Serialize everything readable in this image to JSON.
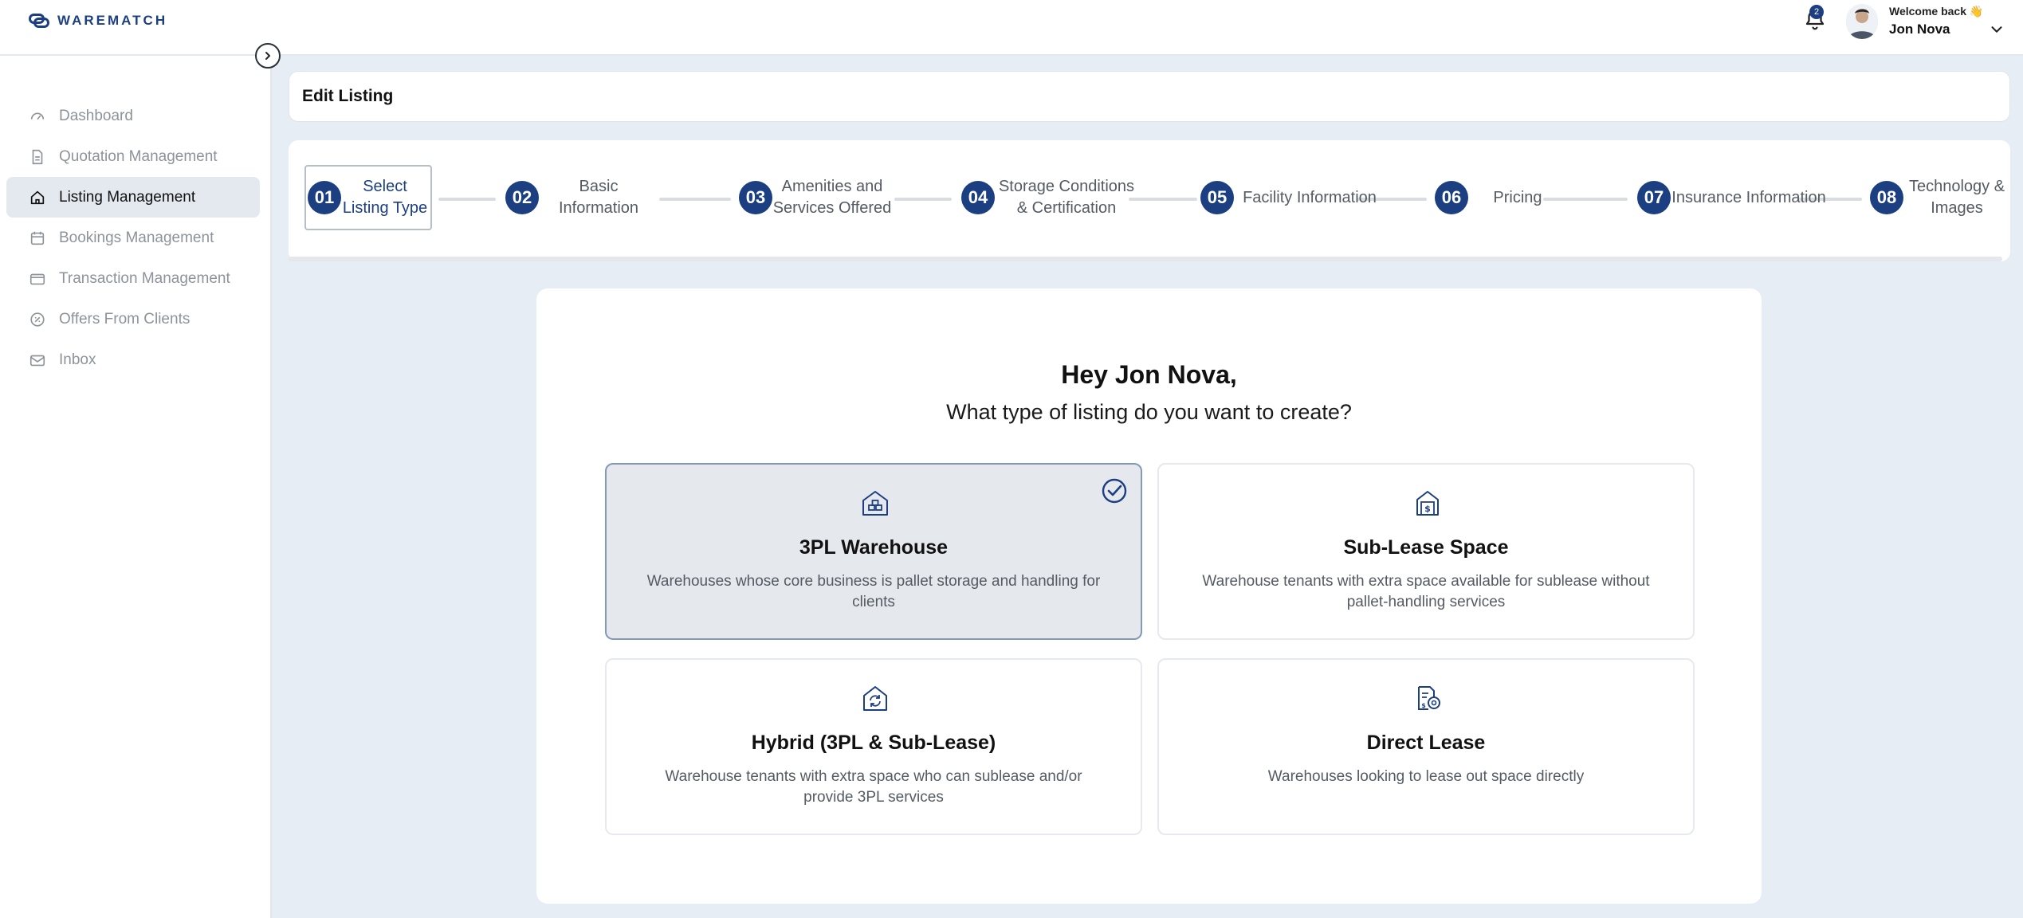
{
  "brand": {
    "name": "WAREMATCH",
    "accent": "#1c3f82"
  },
  "header": {
    "notification_count": "2",
    "welcome": "Welcome back 👋",
    "user_name": "Jon Nova"
  },
  "sidebar": {
    "items": [
      {
        "label": "Dashboard",
        "icon": "gauge-icon"
      },
      {
        "label": "Quotation Management",
        "icon": "document-icon"
      },
      {
        "label": "Listing Management",
        "icon": "home-icon",
        "active": true
      },
      {
        "label": "Bookings Management",
        "icon": "calendar-icon"
      },
      {
        "label": "Transaction Management",
        "icon": "credit-card-icon"
      },
      {
        "label": "Offers From Clients",
        "icon": "discount-icon"
      },
      {
        "label": "Inbox",
        "icon": "mail-icon"
      }
    ]
  },
  "page": {
    "title": "Edit Listing"
  },
  "steps": [
    {
      "num": "01",
      "label": "Select Listing Type",
      "active": true
    },
    {
      "num": "02",
      "label": "Basic Information"
    },
    {
      "num": "03",
      "label": "Amenities and Services Offered"
    },
    {
      "num": "04",
      "label": "Storage Conditions & Certification"
    },
    {
      "num": "05",
      "label": "Facility Information"
    },
    {
      "num": "06",
      "label": "Pricing"
    },
    {
      "num": "07",
      "label": "Insurance Information"
    },
    {
      "num": "08",
      "label": "Technology & Images"
    }
  ],
  "main": {
    "greeting": "Hey Jon Nova,",
    "question": "What type of listing do you want to create?",
    "options": [
      {
        "title": "3PL Warehouse",
        "desc": "Warehouses whose core business is pallet storage and handling for clients",
        "icon": "warehouse-icon",
        "selected": true
      },
      {
        "title": "Sub-Lease Space",
        "desc": "Warehouse tenants with extra space available for sublease without pallet-handling services",
        "icon": "sublease-building-icon"
      },
      {
        "title": "Hybrid (3PL & Sub-Lease)",
        "desc": "Warehouse tenants with extra space who can sublease and/or provide 3PL services",
        "icon": "hybrid-cycle-icon"
      },
      {
        "title": "Direct Lease",
        "desc": "Warehouses looking to lease out space directly",
        "icon": "lease-document-icon"
      }
    ]
  }
}
